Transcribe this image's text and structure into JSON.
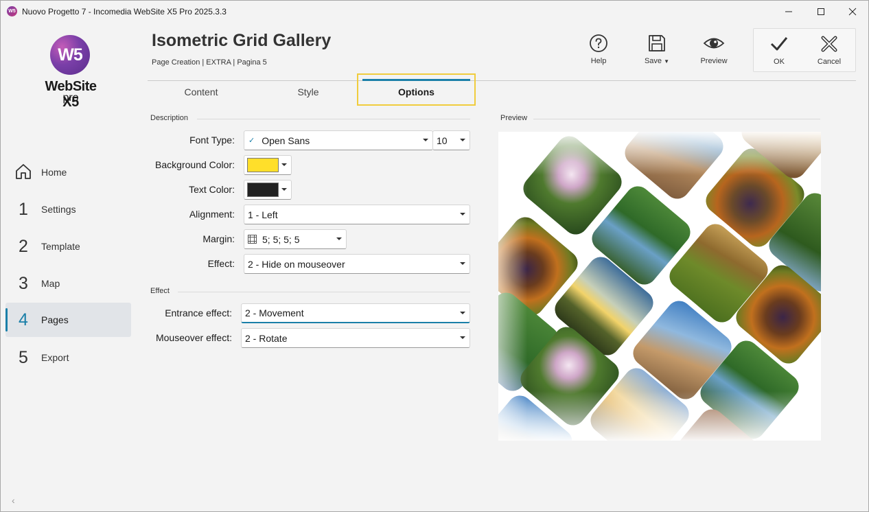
{
  "window": {
    "title": "Nuovo Progetto 7 - Incomedia WebSite X5 Pro 2025.3.3",
    "app_icon_text": "W5"
  },
  "logo": {
    "mark": "W5",
    "name": "WebSite X5",
    "edition": "pro"
  },
  "sidebar": {
    "items": [
      {
        "num": "",
        "icon": "home-icon",
        "label": "Home"
      },
      {
        "num": "1",
        "label": "Settings"
      },
      {
        "num": "2",
        "label": "Template"
      },
      {
        "num": "3",
        "label": "Map"
      },
      {
        "num": "4",
        "label": "Pages",
        "active": true
      },
      {
        "num": "5",
        "label": "Export"
      }
    ],
    "collapse": "‹"
  },
  "header": {
    "title": "Isometric Grid Gallery",
    "breadcrumb": "Page Creation | EXTRA | Pagina 5"
  },
  "toolbar": {
    "help": "Help",
    "save": "Save",
    "preview": "Preview",
    "ok": "OK",
    "cancel": "Cancel"
  },
  "tabs": [
    "Content",
    "Style",
    "Options"
  ],
  "description": {
    "section": "Description",
    "font_type_label": "Font Type:",
    "font_type_value": "Open Sans",
    "font_size_value": "10",
    "bg_color_label": "Background Color:",
    "bg_color": "#ffdf2a",
    "text_color_label": "Text Color:",
    "text_color": "#222222",
    "alignment_label": "Alignment:",
    "alignment_value": "1 - Left",
    "margin_label": "Margin:",
    "margin_value": "5; 5; 5; 5",
    "effect_label": "Effect:",
    "effect_value": "2 - Hide on mouseover"
  },
  "effect": {
    "section": "Effect",
    "entrance_label": "Entrance effect:",
    "entrance_value": "2 - Movement",
    "mouseover_label": "Mouseover effect:",
    "mouseover_value": "2 - Rotate"
  },
  "preview": {
    "section": "Preview"
  },
  "colors": {
    "accent": "#1a7fa8",
    "highlight": "#f0cc3c"
  }
}
